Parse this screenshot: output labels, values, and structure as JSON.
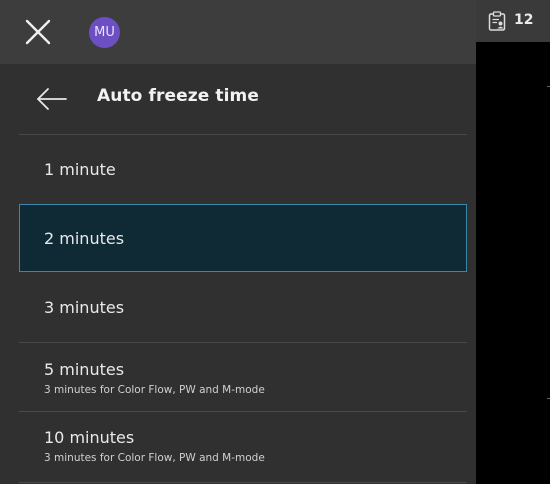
{
  "topbar": {
    "avatar_initials": "MU",
    "close_icon": "close-icon",
    "avatar_color": "#6c4fc3"
  },
  "header": {
    "title": "Auto freeze time",
    "back_icon": "arrow-left-icon"
  },
  "options": [
    {
      "label": "1 minute",
      "sub": "",
      "selected": false
    },
    {
      "label": "2 minutes",
      "sub": "",
      "selected": true
    },
    {
      "label": "3 minutes",
      "sub": "",
      "selected": false
    },
    {
      "label": "5 minutes",
      "sub": "3 minutes for Color Flow, PW and M-mode",
      "selected": false
    },
    {
      "label": "10 minutes",
      "sub": "3 minutes for Color Flow, PW and M-mode",
      "selected": false
    }
  ],
  "right_panel": {
    "count": "12",
    "icon": "clipboard-user-icon"
  },
  "colors": {
    "selected_bg": "#0f2a35",
    "selected_border": "#3a86ad"
  }
}
